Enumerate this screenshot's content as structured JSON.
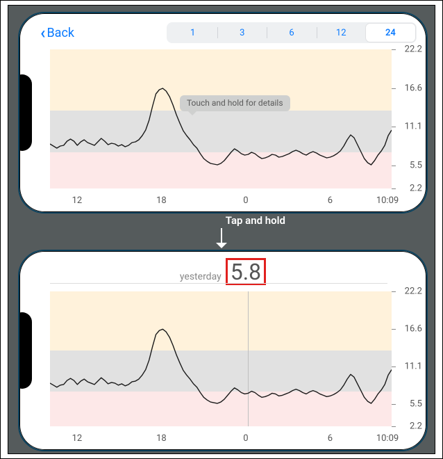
{
  "nav": {
    "back_label": "Back",
    "segments": [
      "1",
      "3",
      "6",
      "12",
      "24"
    ],
    "selected_index": 4
  },
  "annotation": {
    "label": "Tap and hold"
  },
  "readout": {
    "label": "yesterday",
    "value": "5.8"
  },
  "tooltip": {
    "text": "Touch and hold for details"
  },
  "chart_data": {
    "type": "line",
    "ylim": [
      2.2,
      22.2
    ],
    "yticks": [
      22.2,
      16.6,
      11.1,
      5.5,
      2.2
    ],
    "x_ticks": [
      {
        "label": "12",
        "frac": 0.08
      },
      {
        "label": "18",
        "frac": 0.33
      },
      {
        "label": "0",
        "frac": 0.58
      },
      {
        "label": "6",
        "frac": 0.83
      },
      {
        "label": "10:09",
        "frac": 1.0
      }
    ],
    "target_band": {
      "low": 5.5,
      "high": 11.1
    },
    "cursor_frac_bottom": 0.58,
    "values": [
      8.6,
      8.3,
      8.0,
      8.3,
      8.4,
      9.0,
      9.3,
      9.0,
      8.4,
      8.9,
      9.2,
      8.8,
      8.6,
      8.4,
      8.9,
      9.4,
      9.0,
      8.5,
      8.7,
      8.6,
      8.3,
      8.5,
      8.2,
      8.4,
      8.8,
      8.9,
      9.2,
      9.8,
      10.6,
      12.0,
      14.0,
      15.8,
      16.4,
      16.6,
      16.2,
      15.4,
      14.2,
      12.8,
      11.6,
      10.5,
      9.8,
      9.2,
      8.5,
      8.0,
      7.2,
      6.5,
      6.1,
      5.8,
      5.7,
      5.6,
      5.8,
      6.2,
      6.8,
      7.4,
      7.9,
      7.6,
      7.2,
      7.0,
      7.1,
      7.4,
      7.2,
      6.8,
      6.5,
      6.6,
      6.8,
      7.1,
      7.0,
      6.7,
      6.8,
      7.0,
      7.2,
      7.5,
      7.7,
      7.5,
      7.2,
      7.0,
      7.3,
      7.5,
      7.3,
      7.0,
      6.8,
      6.6,
      6.7,
      6.9,
      7.2,
      7.6,
      8.3,
      9.2,
      9.9,
      9.5,
      8.5,
      7.5,
      6.5,
      5.9,
      5.6,
      6.2,
      7.0,
      7.6,
      8.4,
      9.8,
      10.6
    ]
  }
}
